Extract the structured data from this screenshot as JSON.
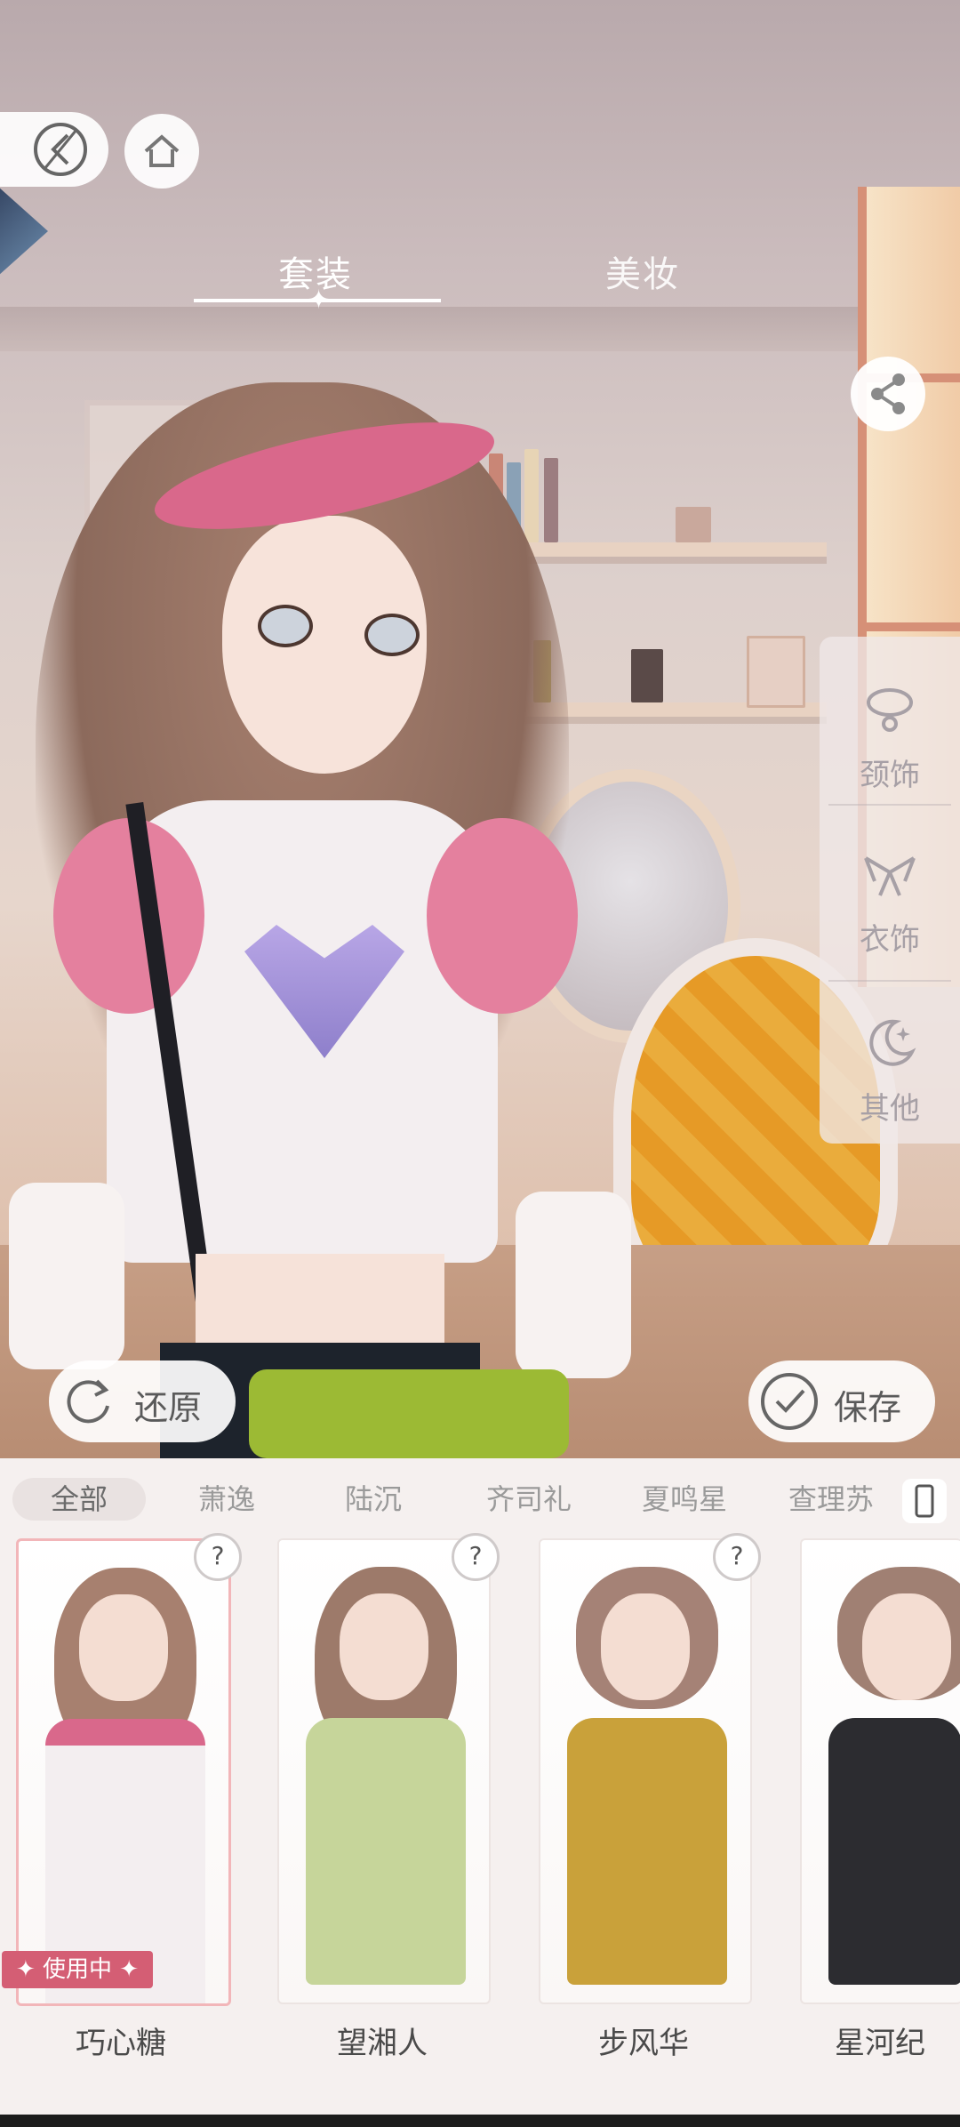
{
  "header": {
    "tabs": [
      {
        "label": "套装",
        "active": true
      },
      {
        "label": "美妆",
        "active": false
      }
    ]
  },
  "side_panel": {
    "items": [
      {
        "label": "颈饰",
        "icon": "necklace-icon"
      },
      {
        "label": "衣饰",
        "icon": "collar-icon"
      },
      {
        "label": "其他",
        "icon": "moon-star-icon"
      }
    ]
  },
  "actions": {
    "restore_label": "还原",
    "save_label": "保存"
  },
  "filters": {
    "items": [
      "全部",
      "萧逸",
      "陆沉",
      "齐司礼",
      "夏鸣星",
      "查理苏"
    ],
    "active_index": 0
  },
  "outfits": [
    {
      "name": "巧心糖",
      "status": "✦ 使用中 ✦",
      "hair_color": "#a7806f",
      "body_color": "#f3eef0",
      "accent": "#d9688b"
    },
    {
      "name": "望湘人",
      "hair_color": "#9d7a6a",
      "body_color": "#c6d59a",
      "accent": "#8fae5b"
    },
    {
      "name": "步风华",
      "hair_color": "#a58276",
      "body_color": "#c9a13a",
      "accent": "#f0ead8"
    },
    {
      "name": "星河纪",
      "hair_color": "#a08073",
      "body_color": "#2c2c30",
      "accent": "#f2c12e"
    }
  ],
  "colors": {
    "accent_pink": "#d45e74",
    "panel_bg": "#f5f0ef",
    "text_gray": "#9a9a9a"
  }
}
